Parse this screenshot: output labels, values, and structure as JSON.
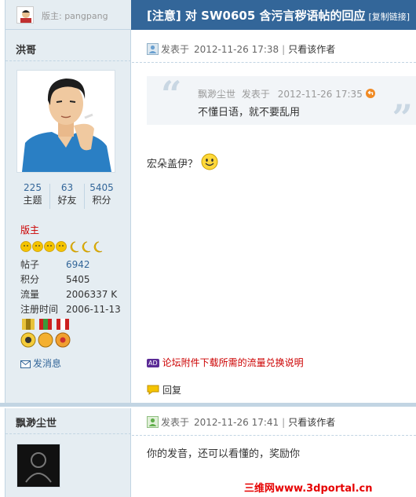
{
  "header": {
    "moderator_label": "版主: pangpang",
    "title": "[注意] 对 SW0605 含污言秽语帖的回应",
    "copy_link": "[复制链接]"
  },
  "post1": {
    "author": {
      "name": "洪哥",
      "stats": [
        {
          "value": "225",
          "label": "主题"
        },
        {
          "value": "63",
          "label": "好友"
        },
        {
          "value": "5405",
          "label": "积分"
        }
      ],
      "group": "版主",
      "info": [
        {
          "key": "帖子",
          "value": "6942"
        },
        {
          "key": "积分",
          "value": "5405"
        },
        {
          "key": "流量",
          "value": "2006337 K"
        },
        {
          "key": "注册时间",
          "value": "2006-11-13"
        }
      ],
      "pm_label": "发消息"
    },
    "posted_label": "发表于",
    "time": "2012-11-26 17:38",
    "only_author": "只看该作者",
    "quote": {
      "author": "飘渺尘世",
      "posted_label": "发表于",
      "time": "2012-11-26 17:35",
      "text": "不懂日语，就不要乱用"
    },
    "body": "宏朵盖伊？",
    "ad_tag": "AD",
    "ad_text": "论坛附件下载所需的流量兑换说明",
    "reply_label": "回复"
  },
  "post2": {
    "author": {
      "name": "飘渺尘世"
    },
    "posted_label": "发表于",
    "time": "2012-11-26 17:41",
    "only_author": "只看该作者",
    "body": "你的发音，还可以看懂的，奖励你"
  },
  "watermark": "三维网www.3dportal.cn"
}
